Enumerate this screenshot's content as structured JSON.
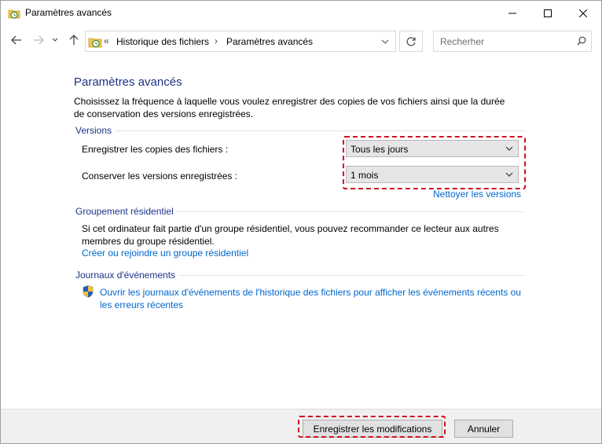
{
  "window": {
    "title": "Paramètres avancés"
  },
  "addressbar": {
    "overflow_glyph": "«",
    "crumbs": [
      "Historique des fichiers",
      "Paramètres avancés"
    ],
    "separator": "›"
  },
  "search": {
    "placeholder": "Recherher"
  },
  "page": {
    "title": "Paramètres avancés",
    "intro": "Choisissez la fréquence à laquelle vous voulez enregistrer des copies de vos fichiers ainsi que la durée de conservation des versions enregistrées."
  },
  "versions": {
    "heading": "Versions",
    "save_copies_label": "Enregistrer les copies des fichiers :",
    "save_copies_value": "Tous les jours",
    "keep_versions_label": "Conserver les versions enregistrées :",
    "keep_versions_value": "1 mois",
    "cleanup_link": "Nettoyer les versions"
  },
  "homegroup": {
    "heading": "Groupement résidentiel",
    "text": "Si cet ordinateur fait partie d'un groupe résidentiel, vous pouvez recommander ce lecteur aux autres membres du groupe résidentiel.",
    "link": "Créer ou rejoindre un groupe résidentiel"
  },
  "eventlogs": {
    "heading": "Journaux d'événements",
    "link": "Ouvrir les journaux d'événements de l'historique des fichiers pour afficher les événements récents ou les erreurs récentes",
    "icon": "uac-shield-icon"
  },
  "footer": {
    "save_label": "Enregistrer les modifications",
    "cancel_label": "Annuler"
  },
  "colors": {
    "heading_blue": "#1e3287",
    "link_blue": "#0066cc",
    "highlight_red": "#d01020"
  }
}
